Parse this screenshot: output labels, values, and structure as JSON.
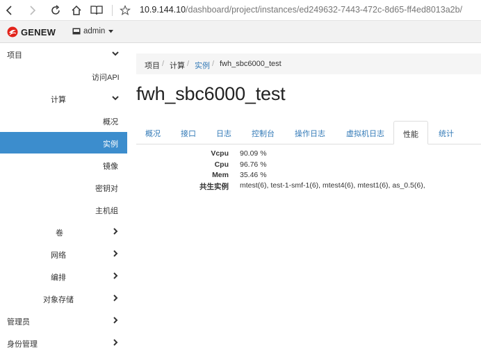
{
  "browser": {
    "url_host": "10.9.144.10",
    "url_path": "/dashboard/project/instances/ed249632-7443-472c-8d65-ff4ed8013a2b/"
  },
  "header": {
    "logo_text": "GENEW",
    "user_menu_label": "admin"
  },
  "sidebar": {
    "items": [
      {
        "label": "项目"
      },
      {
        "label": "访问API"
      },
      {
        "label": "计算"
      },
      {
        "label": "概况"
      },
      {
        "label": "实例"
      },
      {
        "label": "镜像"
      },
      {
        "label": "密钥对"
      },
      {
        "label": "主机组"
      },
      {
        "label": "卷"
      },
      {
        "label": "网络"
      },
      {
        "label": "编排"
      },
      {
        "label": "对象存储"
      },
      {
        "label": "管理员"
      },
      {
        "label": "身份管理"
      }
    ]
  },
  "breadcrumb": {
    "items": [
      "项目",
      "计算",
      "实例",
      "fwh_sbc6000_test"
    ],
    "separator": "/"
  },
  "page": {
    "title": "fwh_sbc6000_test"
  },
  "tabs": [
    {
      "label": "概况"
    },
    {
      "label": "接口"
    },
    {
      "label": "日志"
    },
    {
      "label": "控制台"
    },
    {
      "label": "操作日志"
    },
    {
      "label": "虚拟机日志"
    },
    {
      "label": "性能"
    },
    {
      "label": "统计"
    }
  ],
  "performance": {
    "rows": [
      {
        "key": "Vcpu",
        "value": "90.09 %"
      },
      {
        "key": "Cpu",
        "value": "96.76 %"
      },
      {
        "key": "Mem",
        "value": "35.46 %"
      },
      {
        "key": "共生实例",
        "value": "mtest(6), test-1-smf-1(6), mtest4(6), mtest1(6), as_0.5(6),"
      }
    ]
  },
  "colors": {
    "accent": "#3c8dcd",
    "link": "#337ab7",
    "logo_red": "#e2231a"
  }
}
